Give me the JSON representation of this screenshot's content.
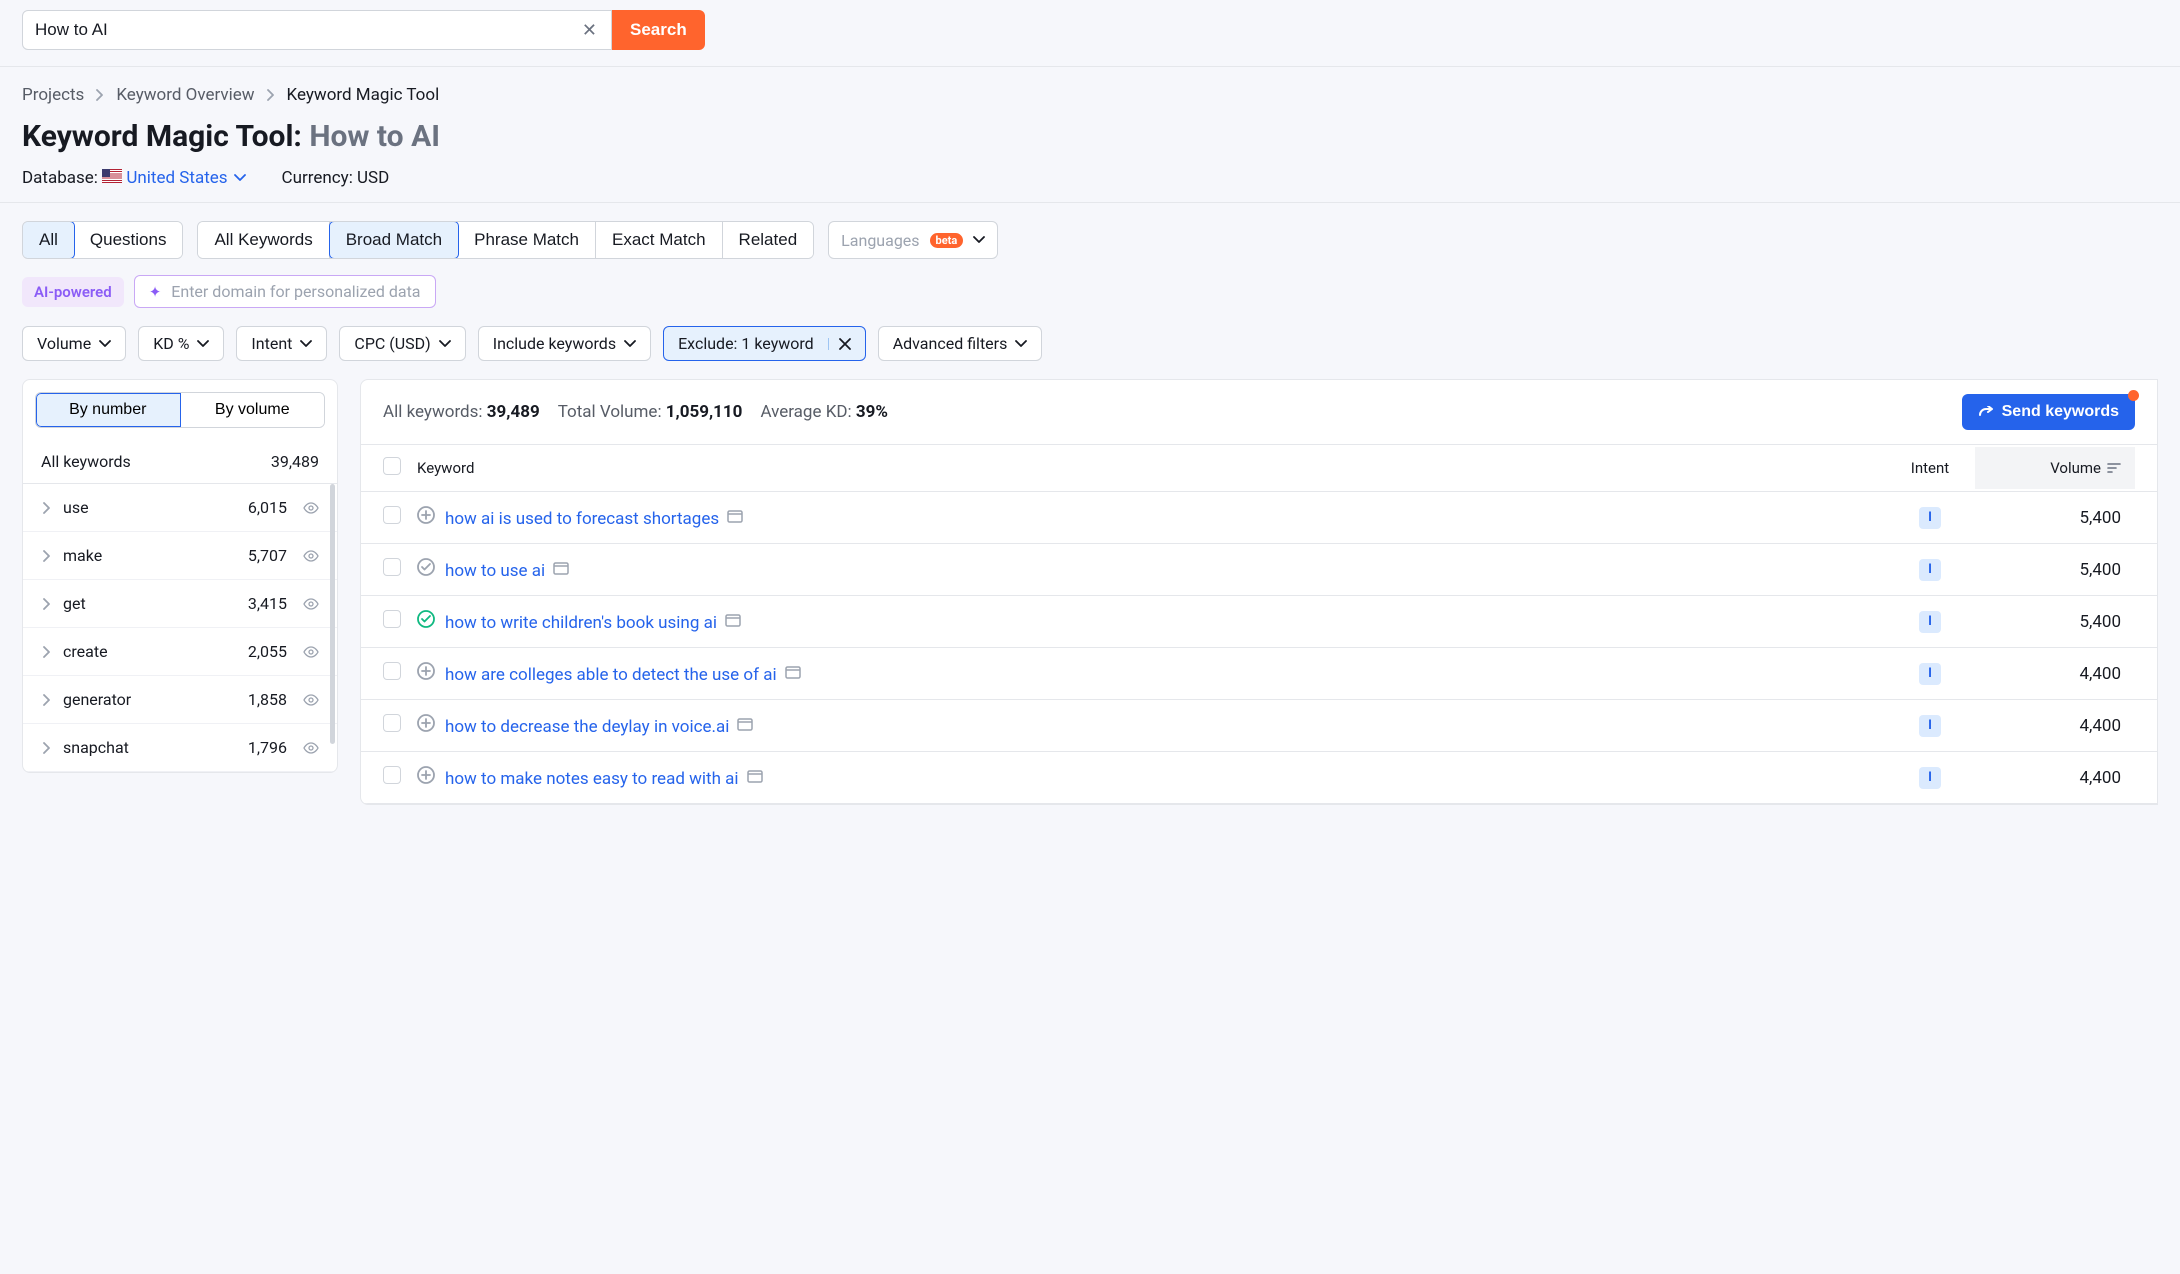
{
  "search": {
    "value": "How to AI",
    "button": "Search"
  },
  "breadcrumb": {
    "items": [
      "Projects",
      "Keyword Overview",
      "Keyword Magic Tool"
    ]
  },
  "title": {
    "prefix": "Keyword Magic Tool:",
    "query": "How to AI"
  },
  "meta": {
    "db_label": "Database:",
    "db_value": "United States",
    "curr_label": "Currency:",
    "curr_value": "USD"
  },
  "seg1": {
    "items": [
      "All",
      "Questions"
    ],
    "active": "All"
  },
  "seg2": {
    "items": [
      "All Keywords",
      "Broad Match",
      "Phrase Match",
      "Exact Match",
      "Related"
    ],
    "active": "Broad Match"
  },
  "lang": {
    "label": "Languages",
    "badge": "beta"
  },
  "ai": {
    "badge": "AI-powered",
    "placeholder": "Enter domain for personalized data"
  },
  "filters": {
    "items": [
      {
        "label": "Volume",
        "active": false
      },
      {
        "label": "KD %",
        "active": false
      },
      {
        "label": "Intent",
        "active": false
      },
      {
        "label": "CPC (USD)",
        "active": false
      },
      {
        "label": "Include keywords",
        "active": false
      },
      {
        "label": "Exclude: 1 keyword",
        "active": true,
        "close": true
      },
      {
        "label": "Advanced filters",
        "active": false
      }
    ]
  },
  "sidebar": {
    "seg": [
      "By number",
      "By volume"
    ],
    "seg_active": "By number",
    "all_label": "All keywords",
    "all_count": "39,489",
    "items": [
      {
        "name": "use",
        "count": "6,015"
      },
      {
        "name": "make",
        "count": "5,707"
      },
      {
        "name": "get",
        "count": "3,415"
      },
      {
        "name": "create",
        "count": "2,055"
      },
      {
        "name": "generator",
        "count": "1,858"
      },
      {
        "name": "snapchat",
        "count": "1,796"
      }
    ]
  },
  "stats": {
    "all_kw_label": "All keywords:",
    "all_kw": "39,489",
    "vol_label": "Total Volume:",
    "vol": "1,059,110",
    "kd_label": "Average KD:",
    "kd": "39%"
  },
  "send_label": "Send keywords",
  "table": {
    "head": {
      "keyword": "Keyword",
      "intent": "Intent",
      "volume": "Volume"
    },
    "rows": [
      {
        "icon": "plus",
        "kw": "how ai is used to forecast shortages",
        "intent": "I",
        "vol": "5,400"
      },
      {
        "icon": "check-grey",
        "kw": "how to use ai",
        "intent": "I",
        "vol": "5,400"
      },
      {
        "icon": "check-green",
        "kw": "how to write children's book using ai",
        "intent": "I",
        "vol": "5,400"
      },
      {
        "icon": "plus",
        "kw": "how are colleges able to detect the use of ai",
        "intent": "I",
        "vol": "4,400"
      },
      {
        "icon": "plus",
        "kw": "how to decrease the deylay in voice.ai",
        "intent": "I",
        "vol": "4,400"
      },
      {
        "icon": "plus",
        "kw": "how to make notes easy to read with ai",
        "intent": "I",
        "vol": "4,400"
      }
    ]
  }
}
